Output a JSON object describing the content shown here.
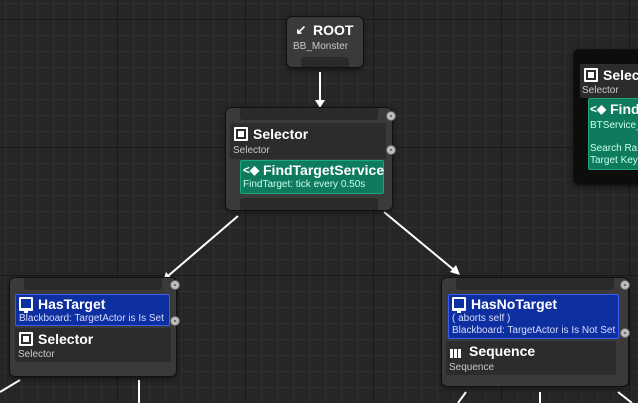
{
  "root": {
    "title": "ROOT",
    "subtitle": "BB_Monster"
  },
  "selector_main": {
    "title": "Selector",
    "subtitle": "Selector",
    "service": {
      "title": "FindTargetService",
      "subtitle": "FindTarget: tick every 0.50s"
    }
  },
  "has_target": {
    "decorator": {
      "title": "HasTarget",
      "subtitle": "Blackboard: TargetActor is Is Set"
    },
    "title": "Selector",
    "subtitle": "Selector"
  },
  "has_no_target": {
    "decorator": {
      "title": "HasNoTarget",
      "line1": "( aborts self )",
      "line2": "Blackboard: TargetActor is Is Not Set"
    },
    "title": "Sequence",
    "subtitle": "Sequence"
  },
  "right_node": {
    "title": "Selecto",
    "subtitle": "Selector",
    "service": {
      "title": "Find",
      "subtitle": "BTService_",
      "line1": "Search Ra",
      "line2": "Target Key"
    }
  },
  "colors": {
    "service": "#0e7a5e",
    "decorator": "#0e2fa0",
    "wire": "#ffffff"
  }
}
